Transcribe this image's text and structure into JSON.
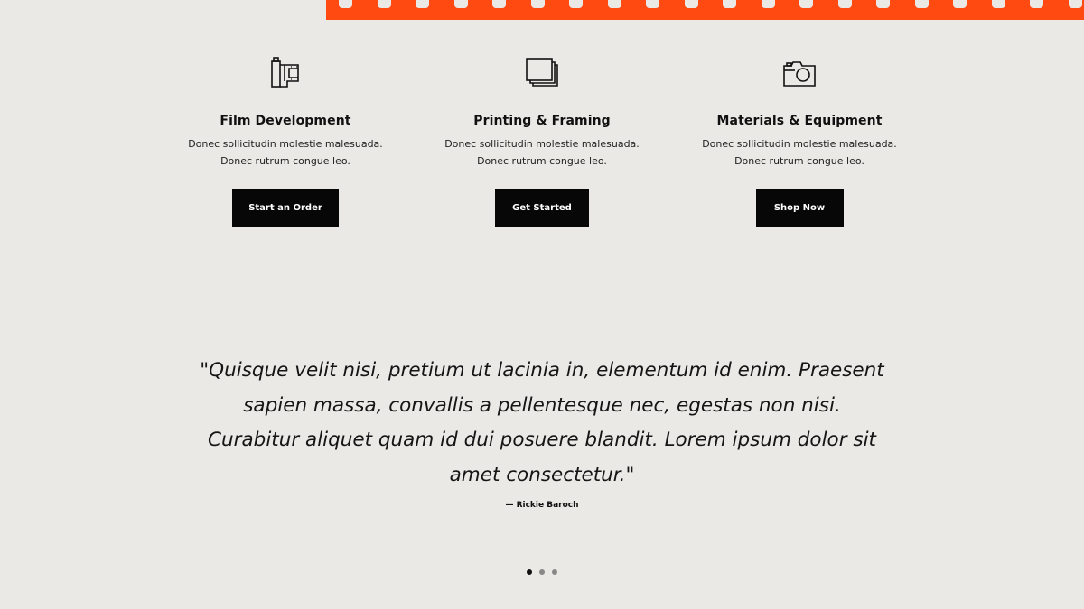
{
  "colors": {
    "accent": "#ff4a12",
    "background": "#ebe9e5",
    "button": "#070707"
  },
  "services": [
    {
      "icon": "film-roll-icon",
      "title": "Film Development",
      "description": "Donec sollicitudin molestie malesuada.\nDonec rutrum congue leo.",
      "button_label": "Start an Order"
    },
    {
      "icon": "photo-stack-icon",
      "title": "Printing & Framing",
      "description": "Donec sollicitudin molestie malesuada.\nDonec rutrum congue leo.",
      "button_label": "Get Started"
    },
    {
      "icon": "camera-icon",
      "title": "Materials & Equipment",
      "description": "Donec sollicitudin molestie malesuada.\nDonec rutrum congue leo.",
      "button_label": "Shop Now"
    }
  ],
  "testimonial": {
    "quote": "\"Quisque velit nisi, pretium ut lacinia in, elementum id enim. Praesent sapien massa, convallis a pellentesque nec, egestas non nisi. Curabitur aliquet quam id dui posuere blandit. Lorem ipsum dolor sit amet consectetur.\"",
    "author": "— Rickie Baroch"
  },
  "carousel": {
    "total_slides": 3,
    "active_slide": 1
  }
}
